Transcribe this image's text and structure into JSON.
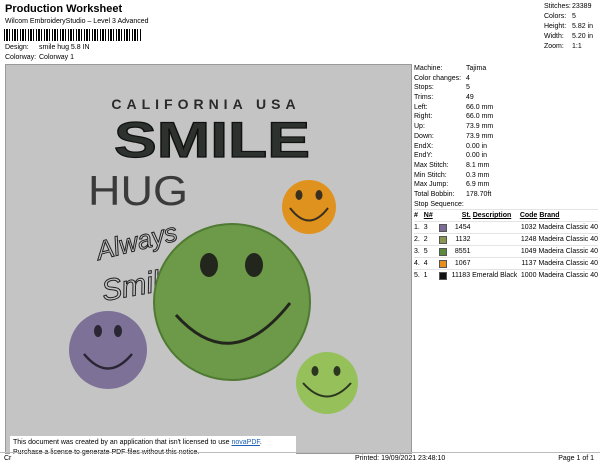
{
  "header": {
    "title": "Production Worksheet",
    "subtitle": "Wilcom EmbroideryStudio – Level 3 Advanced",
    "design_label": "Design:",
    "design_value": "smile hug 5.8 IN",
    "colorway_label": "Colorway:",
    "colorway_value": "Colorway 1"
  },
  "stats": [
    {
      "label": "Stitches:",
      "value": "23389"
    },
    {
      "label": "Colors:",
      "value": "5"
    },
    {
      "label": "Height:",
      "value": "5.82 in"
    },
    {
      "label": "Width:",
      "value": "5.20 in"
    },
    {
      "label": "Zoom:",
      "value": "1:1"
    }
  ],
  "design": {
    "line1": "CALIFORNIA USA",
    "line2": "SMILE",
    "line3": "HUG",
    "script1": "Always",
    "script2": "Smile"
  },
  "properties": [
    {
      "label": "Machine:",
      "value": "Tajima"
    },
    {
      "label": "Color changes:",
      "value": "4"
    },
    {
      "label": "Stops:",
      "value": "5"
    },
    {
      "label": "Trims:",
      "value": "49"
    },
    {
      "label": "Left:",
      "value": "66.0 mm"
    },
    {
      "label": "Right:",
      "value": "66.0 mm"
    },
    {
      "label": "Up:",
      "value": "73.9 mm"
    },
    {
      "label": "Down:",
      "value": "73.9 mm"
    },
    {
      "label": "EndX:",
      "value": "0.00 in"
    },
    {
      "label": "EndY:",
      "value": "0.00 in"
    },
    {
      "label": "Max Stitch:",
      "value": "8.1 mm"
    },
    {
      "label": "Min Stitch:",
      "value": "0.3 mm"
    },
    {
      "label": "Max Jump:",
      "value": "6.9 mm"
    },
    {
      "label": "Total Bobbin:",
      "value": "178.70ft"
    }
  ],
  "stop_sequence": {
    "title": "Stop Sequence:",
    "headers": {
      "n": "#",
      "num": "N#",
      "st": "St.",
      "desc": "Description",
      "code": "Code",
      "brand": "Brand"
    },
    "rows": [
      {
        "n": "1.",
        "num": "3",
        "color": "#7a6c96",
        "st": "1454",
        "desc": "",
        "code": "1032",
        "brand": "Madeira Classic 40"
      },
      {
        "n": "2.",
        "num": "2",
        "color": "#8a9650",
        "st": "1132",
        "desc": "",
        "code": "1248",
        "brand": "Madeira Classic 40"
      },
      {
        "n": "3.",
        "num": "5",
        "color": "#5a8a3c",
        "st": "8551",
        "desc": "",
        "code": "1049",
        "brand": "Madeira Classic 40"
      },
      {
        "n": "4.",
        "num": "4",
        "color": "#e58f1e",
        "st": "1067",
        "desc": "",
        "code": "1137",
        "brand": "Madeira Classic 40"
      },
      {
        "n": "5.",
        "num": "1",
        "color": "#111111",
        "st": "11183",
        "desc": "Emerald Black",
        "code": "1000",
        "brand": "Madeira Classic 40"
      }
    ]
  },
  "notice": {
    "line1_prefix": "This document was created by an application that isn't licensed to use ",
    "link": "novaPDF",
    "line1_suffix": ".",
    "line2": "Purchase a license to generate PDF files without this notice."
  },
  "footer": {
    "left": "Cr",
    "printed": "Printed: 19/09/2021 23:48:10",
    "page": "Page 1 of 1"
  }
}
